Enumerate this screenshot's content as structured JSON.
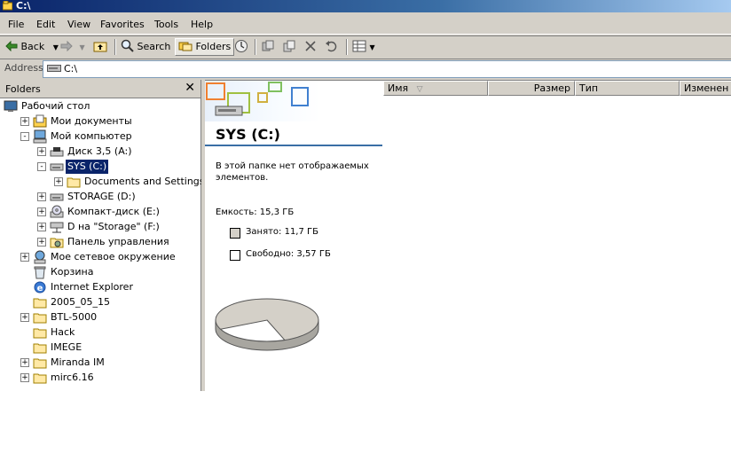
{
  "window": {
    "title": "C:\\"
  },
  "menu": [
    "File",
    "Edit",
    "View",
    "Favorites",
    "Tools",
    "Help"
  ],
  "toolbar": {
    "back": "Back",
    "search": "Search",
    "folders": "Folders"
  },
  "address": {
    "label": "Address",
    "value": "C:\\"
  },
  "folders_pane": {
    "title": "Folders",
    "close": "✕",
    "items": [
      {
        "label": "Рабочий стол",
        "icon": "desktop-icon"
      },
      {
        "label": "Мои документы",
        "icon": "my-documents-icon"
      },
      {
        "label": "Мой компьютер",
        "icon": "my-computer-icon"
      },
      {
        "label": "Диск 3,5 (A:)",
        "icon": "floppy-drive-icon"
      },
      {
        "label": "SYS (C:)",
        "icon": "hard-drive-icon"
      },
      {
        "label": "Documents and Settings",
        "icon": "folder-icon"
      },
      {
        "label": "STORAGE (D:)",
        "icon": "hard-drive-icon"
      },
      {
        "label": "Компакт-диск (E:)",
        "icon": "cd-drive-icon"
      },
      {
        "label": "D на \"Storage\" (F:)",
        "icon": "network-drive-icon"
      },
      {
        "label": "Панель управления",
        "icon": "control-panel-icon"
      },
      {
        "label": "Мое сетевое окружение",
        "icon": "network-places-icon"
      },
      {
        "label": "Корзина",
        "icon": "recycle-bin-icon"
      },
      {
        "label": "Internet Explorer",
        "icon": "internet-explorer-icon"
      },
      {
        "label": "2005_05_15",
        "icon": "folder-icon"
      },
      {
        "label": "BTL-5000",
        "icon": "folder-icon"
      },
      {
        "label": "Hack",
        "icon": "folder-icon"
      },
      {
        "label": "IMEGE",
        "icon": "folder-icon"
      },
      {
        "label": "Miranda IM",
        "icon": "folder-icon"
      },
      {
        "label": "mirc6.16",
        "icon": "folder-icon"
      }
    ]
  },
  "drive_info": {
    "title": "SYS (C:)",
    "empty_message": "В этой папке нет отображаемых элементов.",
    "capacity": "Емкость: 15,3 ГБ",
    "used": "Занято: 11,7 ГБ",
    "free": "Свободно: 3,57 ГБ",
    "used_fraction": 0.765,
    "used_color": "#d4d0c8",
    "free_color": "#ffffff"
  },
  "columns": [
    "Имя",
    "Размер",
    "Тип",
    "Изменен"
  ],
  "colors": {
    "selection": "#0a246a",
    "title_bar": "#0a246a"
  }
}
